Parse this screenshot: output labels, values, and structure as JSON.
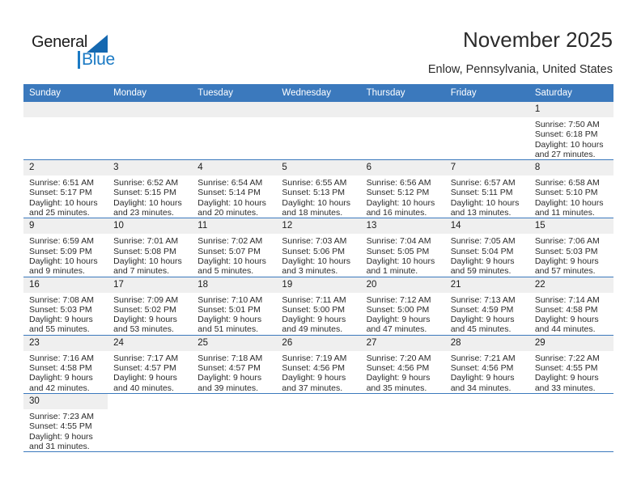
{
  "brand": {
    "name_part1": "General",
    "name_part2": "Blue",
    "flag_color": "#1568b0",
    "blue_color": "#1b7ac4"
  },
  "header": {
    "title": "November 2025",
    "location": "Enlow, Pennsylvania, United States"
  },
  "calendar": {
    "header_bg": "#3b79bd",
    "daynum_bg": "#efefef",
    "weekdays": [
      "Sunday",
      "Monday",
      "Tuesday",
      "Wednesday",
      "Thursday",
      "Friday",
      "Saturday"
    ],
    "weeks": [
      [
        {
          "day": "",
          "sunrise": "",
          "sunset": "",
          "daylight1": "",
          "daylight2": "",
          "empty": true
        },
        {
          "day": "",
          "sunrise": "",
          "sunset": "",
          "daylight1": "",
          "daylight2": "",
          "empty": true
        },
        {
          "day": "",
          "sunrise": "",
          "sunset": "",
          "daylight1": "",
          "daylight2": "",
          "empty": true
        },
        {
          "day": "",
          "sunrise": "",
          "sunset": "",
          "daylight1": "",
          "daylight2": "",
          "empty": true
        },
        {
          "day": "",
          "sunrise": "",
          "sunset": "",
          "daylight1": "",
          "daylight2": "",
          "empty": true
        },
        {
          "day": "",
          "sunrise": "",
          "sunset": "",
          "daylight1": "",
          "daylight2": "",
          "empty": true
        },
        {
          "day": "1",
          "sunrise": "Sunrise: 7:50 AM",
          "sunset": "Sunset: 6:18 PM",
          "daylight1": "Daylight: 10 hours",
          "daylight2": "and 27 minutes."
        }
      ],
      [
        {
          "day": "2",
          "sunrise": "Sunrise: 6:51 AM",
          "sunset": "Sunset: 5:17 PM",
          "daylight1": "Daylight: 10 hours",
          "daylight2": "and 25 minutes."
        },
        {
          "day": "3",
          "sunrise": "Sunrise: 6:52 AM",
          "sunset": "Sunset: 5:15 PM",
          "daylight1": "Daylight: 10 hours",
          "daylight2": "and 23 minutes."
        },
        {
          "day": "4",
          "sunrise": "Sunrise: 6:54 AM",
          "sunset": "Sunset: 5:14 PM",
          "daylight1": "Daylight: 10 hours",
          "daylight2": "and 20 minutes."
        },
        {
          "day": "5",
          "sunrise": "Sunrise: 6:55 AM",
          "sunset": "Sunset: 5:13 PM",
          "daylight1": "Daylight: 10 hours",
          "daylight2": "and 18 minutes."
        },
        {
          "day": "6",
          "sunrise": "Sunrise: 6:56 AM",
          "sunset": "Sunset: 5:12 PM",
          "daylight1": "Daylight: 10 hours",
          "daylight2": "and 16 minutes."
        },
        {
          "day": "7",
          "sunrise": "Sunrise: 6:57 AM",
          "sunset": "Sunset: 5:11 PM",
          "daylight1": "Daylight: 10 hours",
          "daylight2": "and 13 minutes."
        },
        {
          "day": "8",
          "sunrise": "Sunrise: 6:58 AM",
          "sunset": "Sunset: 5:10 PM",
          "daylight1": "Daylight: 10 hours",
          "daylight2": "and 11 minutes."
        }
      ],
      [
        {
          "day": "9",
          "sunrise": "Sunrise: 6:59 AM",
          "sunset": "Sunset: 5:09 PM",
          "daylight1": "Daylight: 10 hours",
          "daylight2": "and 9 minutes."
        },
        {
          "day": "10",
          "sunrise": "Sunrise: 7:01 AM",
          "sunset": "Sunset: 5:08 PM",
          "daylight1": "Daylight: 10 hours",
          "daylight2": "and 7 minutes."
        },
        {
          "day": "11",
          "sunrise": "Sunrise: 7:02 AM",
          "sunset": "Sunset: 5:07 PM",
          "daylight1": "Daylight: 10 hours",
          "daylight2": "and 5 minutes."
        },
        {
          "day": "12",
          "sunrise": "Sunrise: 7:03 AM",
          "sunset": "Sunset: 5:06 PM",
          "daylight1": "Daylight: 10 hours",
          "daylight2": "and 3 minutes."
        },
        {
          "day": "13",
          "sunrise": "Sunrise: 7:04 AM",
          "sunset": "Sunset: 5:05 PM",
          "daylight1": "Daylight: 10 hours",
          "daylight2": "and 1 minute."
        },
        {
          "day": "14",
          "sunrise": "Sunrise: 7:05 AM",
          "sunset": "Sunset: 5:04 PM",
          "daylight1": "Daylight: 9 hours",
          "daylight2": "and 59 minutes."
        },
        {
          "day": "15",
          "sunrise": "Sunrise: 7:06 AM",
          "sunset": "Sunset: 5:03 PM",
          "daylight1": "Daylight: 9 hours",
          "daylight2": "and 57 minutes."
        }
      ],
      [
        {
          "day": "16",
          "sunrise": "Sunrise: 7:08 AM",
          "sunset": "Sunset: 5:03 PM",
          "daylight1": "Daylight: 9 hours",
          "daylight2": "and 55 minutes."
        },
        {
          "day": "17",
          "sunrise": "Sunrise: 7:09 AM",
          "sunset": "Sunset: 5:02 PM",
          "daylight1": "Daylight: 9 hours",
          "daylight2": "and 53 minutes."
        },
        {
          "day": "18",
          "sunrise": "Sunrise: 7:10 AM",
          "sunset": "Sunset: 5:01 PM",
          "daylight1": "Daylight: 9 hours",
          "daylight2": "and 51 minutes."
        },
        {
          "day": "19",
          "sunrise": "Sunrise: 7:11 AM",
          "sunset": "Sunset: 5:00 PM",
          "daylight1": "Daylight: 9 hours",
          "daylight2": "and 49 minutes."
        },
        {
          "day": "20",
          "sunrise": "Sunrise: 7:12 AM",
          "sunset": "Sunset: 5:00 PM",
          "daylight1": "Daylight: 9 hours",
          "daylight2": "and 47 minutes."
        },
        {
          "day": "21",
          "sunrise": "Sunrise: 7:13 AM",
          "sunset": "Sunset: 4:59 PM",
          "daylight1": "Daylight: 9 hours",
          "daylight2": "and 45 minutes."
        },
        {
          "day": "22",
          "sunrise": "Sunrise: 7:14 AM",
          "sunset": "Sunset: 4:58 PM",
          "daylight1": "Daylight: 9 hours",
          "daylight2": "and 44 minutes."
        }
      ],
      [
        {
          "day": "23",
          "sunrise": "Sunrise: 7:16 AM",
          "sunset": "Sunset: 4:58 PM",
          "daylight1": "Daylight: 9 hours",
          "daylight2": "and 42 minutes."
        },
        {
          "day": "24",
          "sunrise": "Sunrise: 7:17 AM",
          "sunset": "Sunset: 4:57 PM",
          "daylight1": "Daylight: 9 hours",
          "daylight2": "and 40 minutes."
        },
        {
          "day": "25",
          "sunrise": "Sunrise: 7:18 AM",
          "sunset": "Sunset: 4:57 PM",
          "daylight1": "Daylight: 9 hours",
          "daylight2": "and 39 minutes."
        },
        {
          "day": "26",
          "sunrise": "Sunrise: 7:19 AM",
          "sunset": "Sunset: 4:56 PM",
          "daylight1": "Daylight: 9 hours",
          "daylight2": "and 37 minutes."
        },
        {
          "day": "27",
          "sunrise": "Sunrise: 7:20 AM",
          "sunset": "Sunset: 4:56 PM",
          "daylight1": "Daylight: 9 hours",
          "daylight2": "and 35 minutes."
        },
        {
          "day": "28",
          "sunrise": "Sunrise: 7:21 AM",
          "sunset": "Sunset: 4:56 PM",
          "daylight1": "Daylight: 9 hours",
          "daylight2": "and 34 minutes."
        },
        {
          "day": "29",
          "sunrise": "Sunrise: 7:22 AM",
          "sunset": "Sunset: 4:55 PM",
          "daylight1": "Daylight: 9 hours",
          "daylight2": "and 33 minutes."
        }
      ],
      [
        {
          "day": "30",
          "sunrise": "Sunrise: 7:23 AM",
          "sunset": "Sunset: 4:55 PM",
          "daylight1": "Daylight: 9 hours",
          "daylight2": "and 31 minutes."
        },
        {
          "day": "",
          "sunrise": "",
          "sunset": "",
          "daylight1": "",
          "daylight2": "",
          "blank": true
        },
        {
          "day": "",
          "sunrise": "",
          "sunset": "",
          "daylight1": "",
          "daylight2": "",
          "blank": true
        },
        {
          "day": "",
          "sunrise": "",
          "sunset": "",
          "daylight1": "",
          "daylight2": "",
          "blank": true
        },
        {
          "day": "",
          "sunrise": "",
          "sunset": "",
          "daylight1": "",
          "daylight2": "",
          "blank": true
        },
        {
          "day": "",
          "sunrise": "",
          "sunset": "",
          "daylight1": "",
          "daylight2": "",
          "blank": true
        },
        {
          "day": "",
          "sunrise": "",
          "sunset": "",
          "daylight1": "",
          "daylight2": "",
          "blank": true
        }
      ]
    ]
  }
}
